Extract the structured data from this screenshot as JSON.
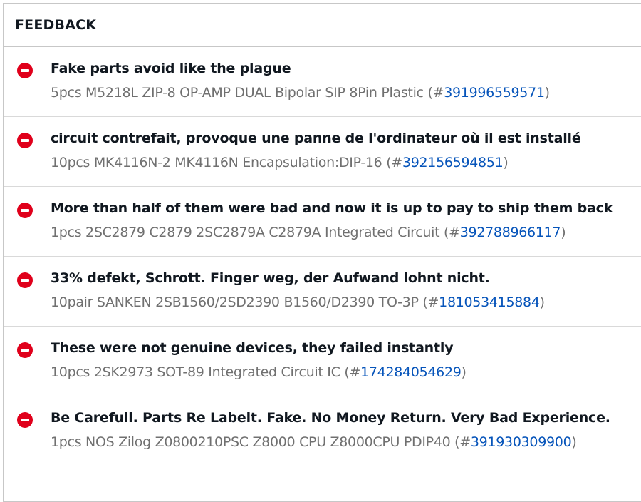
{
  "header": {
    "title": "FEEDBACK"
  },
  "feedback": [
    {
      "rating": "negative",
      "comment": "Fake parts avoid like the plague",
      "item_title": "5pcs M5218L ZIP-8 OP-AMP DUAL Bipolar SIP 8Pin Plastic",
      "item_number": "391996559571"
    },
    {
      "rating": "negative",
      "comment": "circuit contrefait, provoque une panne de l'ordinateur où il est installé",
      "item_title": "10pcs MK4116N-2 MK4116N Encapsulation:DIP-16",
      "item_number": "392156594851"
    },
    {
      "rating": "negative",
      "comment": "More than half of them were bad and now it is up to pay to ship them back",
      "item_title": "1pcs 2SC2879 C2879 2SC2879A C2879A Integrated Circuit",
      "item_number": "392788966117"
    },
    {
      "rating": "negative",
      "comment": "33% defekt, Schrott. Finger weg, der Aufwand lohnt nicht.",
      "item_title": "10pair SANKEN 2SB1560/2SD2390 B1560/D2390 TO-3P",
      "item_number": "181053415884"
    },
    {
      "rating": "negative",
      "comment": "These were not genuine devices, they failed instantly",
      "item_title": "10pcs 2SK2973 SOT-89 Integrated Circuit IC",
      "item_number": "174284054629"
    },
    {
      "rating": "negative",
      "comment": "Be Carefull. Parts Re Labelt. Fake. No Money Return. Very Bad Experience.",
      "item_title": "1pcs NOS Zilog Z0800210PSC Z8000 CPU Z8000CPU PDIP40",
      "item_number": "391930309900"
    }
  ],
  "colors": {
    "negative_icon": "#e0001b",
    "link": "#0654ba",
    "muted_text": "#707070",
    "primary_text": "#111820",
    "border": "#c7c7c7"
  },
  "icons": {
    "negative_rating": "minus-circle-icon"
  }
}
